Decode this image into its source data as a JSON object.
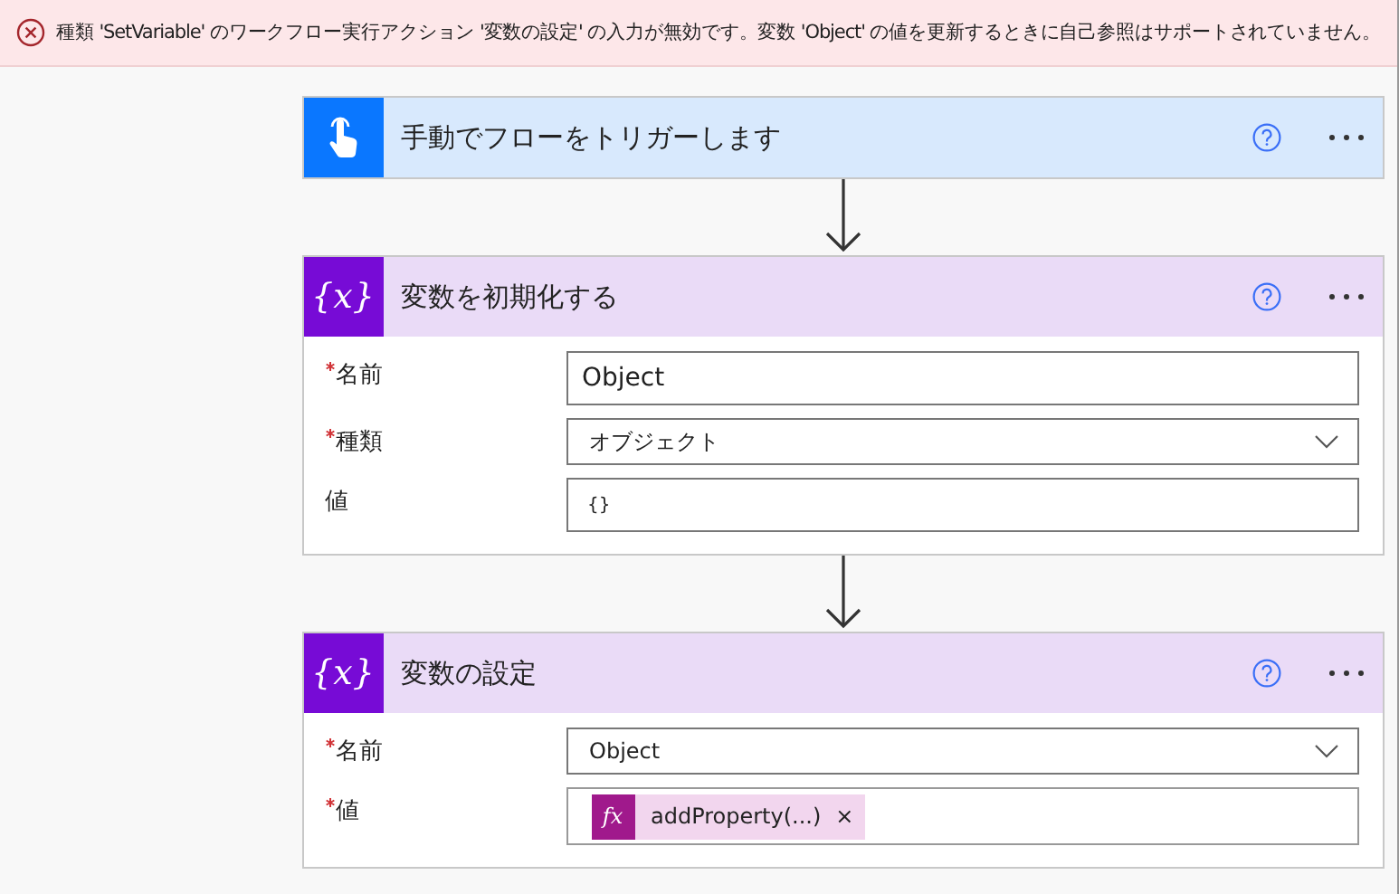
{
  "error_banner": {
    "message": "種類 'SetVariable' のワークフロー実行アクション '変数の設定' の入力が無効です。変数 'Object' の値を更新するときに自己参照はサポートされていません。"
  },
  "cards": [
    {
      "kind": "trigger",
      "title": "手動でフローをトリガーします"
    },
    {
      "kind": "variable",
      "icon_text": "{x}",
      "title": "変数を初期化する",
      "fields": [
        {
          "kind": "text",
          "label": "名前",
          "required": true,
          "value": "Object"
        },
        {
          "kind": "dropdown",
          "label": "種類",
          "required": true,
          "value": "オブジェクト"
        },
        {
          "kind": "text",
          "label": "値",
          "required": false,
          "value": "{}"
        }
      ]
    },
    {
      "kind": "variable",
      "icon_text": "{x}",
      "title": "変数の設定",
      "fields": [
        {
          "kind": "dropdown",
          "label": "名前",
          "required": true,
          "value": "Object"
        },
        {
          "kind": "token",
          "label": "値",
          "required": true,
          "token_icon": "fx",
          "token": "addProperty(...)",
          "remove": "×"
        }
      ]
    }
  ]
}
